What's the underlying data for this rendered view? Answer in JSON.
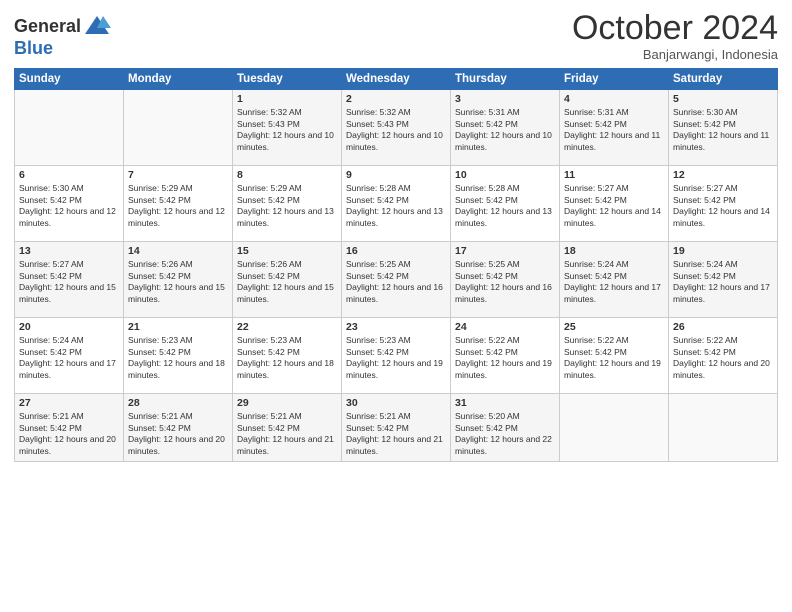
{
  "header": {
    "logo_line1": "General",
    "logo_line2": "Blue",
    "month": "October 2024",
    "location": "Banjarwangi, Indonesia"
  },
  "days_of_week": [
    "Sunday",
    "Monday",
    "Tuesday",
    "Wednesday",
    "Thursday",
    "Friday",
    "Saturday"
  ],
  "weeks": [
    [
      {
        "num": "",
        "info": ""
      },
      {
        "num": "",
        "info": ""
      },
      {
        "num": "1",
        "info": "Sunrise: 5:32 AM\nSunset: 5:43 PM\nDaylight: 12 hours and 10 minutes."
      },
      {
        "num": "2",
        "info": "Sunrise: 5:32 AM\nSunset: 5:43 PM\nDaylight: 12 hours and 10 minutes."
      },
      {
        "num": "3",
        "info": "Sunrise: 5:31 AM\nSunset: 5:42 PM\nDaylight: 12 hours and 10 minutes."
      },
      {
        "num": "4",
        "info": "Sunrise: 5:31 AM\nSunset: 5:42 PM\nDaylight: 12 hours and 11 minutes."
      },
      {
        "num": "5",
        "info": "Sunrise: 5:30 AM\nSunset: 5:42 PM\nDaylight: 12 hours and 11 minutes."
      }
    ],
    [
      {
        "num": "6",
        "info": "Sunrise: 5:30 AM\nSunset: 5:42 PM\nDaylight: 12 hours and 12 minutes."
      },
      {
        "num": "7",
        "info": "Sunrise: 5:29 AM\nSunset: 5:42 PM\nDaylight: 12 hours and 12 minutes."
      },
      {
        "num": "8",
        "info": "Sunrise: 5:29 AM\nSunset: 5:42 PM\nDaylight: 12 hours and 13 minutes."
      },
      {
        "num": "9",
        "info": "Sunrise: 5:28 AM\nSunset: 5:42 PM\nDaylight: 12 hours and 13 minutes."
      },
      {
        "num": "10",
        "info": "Sunrise: 5:28 AM\nSunset: 5:42 PM\nDaylight: 12 hours and 13 minutes."
      },
      {
        "num": "11",
        "info": "Sunrise: 5:27 AM\nSunset: 5:42 PM\nDaylight: 12 hours and 14 minutes."
      },
      {
        "num": "12",
        "info": "Sunrise: 5:27 AM\nSunset: 5:42 PM\nDaylight: 12 hours and 14 minutes."
      }
    ],
    [
      {
        "num": "13",
        "info": "Sunrise: 5:27 AM\nSunset: 5:42 PM\nDaylight: 12 hours and 15 minutes."
      },
      {
        "num": "14",
        "info": "Sunrise: 5:26 AM\nSunset: 5:42 PM\nDaylight: 12 hours and 15 minutes."
      },
      {
        "num": "15",
        "info": "Sunrise: 5:26 AM\nSunset: 5:42 PM\nDaylight: 12 hours and 15 minutes."
      },
      {
        "num": "16",
        "info": "Sunrise: 5:25 AM\nSunset: 5:42 PM\nDaylight: 12 hours and 16 minutes."
      },
      {
        "num": "17",
        "info": "Sunrise: 5:25 AM\nSunset: 5:42 PM\nDaylight: 12 hours and 16 minutes."
      },
      {
        "num": "18",
        "info": "Sunrise: 5:24 AM\nSunset: 5:42 PM\nDaylight: 12 hours and 17 minutes."
      },
      {
        "num": "19",
        "info": "Sunrise: 5:24 AM\nSunset: 5:42 PM\nDaylight: 12 hours and 17 minutes."
      }
    ],
    [
      {
        "num": "20",
        "info": "Sunrise: 5:24 AM\nSunset: 5:42 PM\nDaylight: 12 hours and 17 minutes."
      },
      {
        "num": "21",
        "info": "Sunrise: 5:23 AM\nSunset: 5:42 PM\nDaylight: 12 hours and 18 minutes."
      },
      {
        "num": "22",
        "info": "Sunrise: 5:23 AM\nSunset: 5:42 PM\nDaylight: 12 hours and 18 minutes."
      },
      {
        "num": "23",
        "info": "Sunrise: 5:23 AM\nSunset: 5:42 PM\nDaylight: 12 hours and 19 minutes."
      },
      {
        "num": "24",
        "info": "Sunrise: 5:22 AM\nSunset: 5:42 PM\nDaylight: 12 hours and 19 minutes."
      },
      {
        "num": "25",
        "info": "Sunrise: 5:22 AM\nSunset: 5:42 PM\nDaylight: 12 hours and 19 minutes."
      },
      {
        "num": "26",
        "info": "Sunrise: 5:22 AM\nSunset: 5:42 PM\nDaylight: 12 hours and 20 minutes."
      }
    ],
    [
      {
        "num": "27",
        "info": "Sunrise: 5:21 AM\nSunset: 5:42 PM\nDaylight: 12 hours and 20 minutes."
      },
      {
        "num": "28",
        "info": "Sunrise: 5:21 AM\nSunset: 5:42 PM\nDaylight: 12 hours and 20 minutes."
      },
      {
        "num": "29",
        "info": "Sunrise: 5:21 AM\nSunset: 5:42 PM\nDaylight: 12 hours and 21 minutes."
      },
      {
        "num": "30",
        "info": "Sunrise: 5:21 AM\nSunset: 5:42 PM\nDaylight: 12 hours and 21 minutes."
      },
      {
        "num": "31",
        "info": "Sunrise: 5:20 AM\nSunset: 5:42 PM\nDaylight: 12 hours and 22 minutes."
      },
      {
        "num": "",
        "info": ""
      },
      {
        "num": "",
        "info": ""
      }
    ]
  ]
}
